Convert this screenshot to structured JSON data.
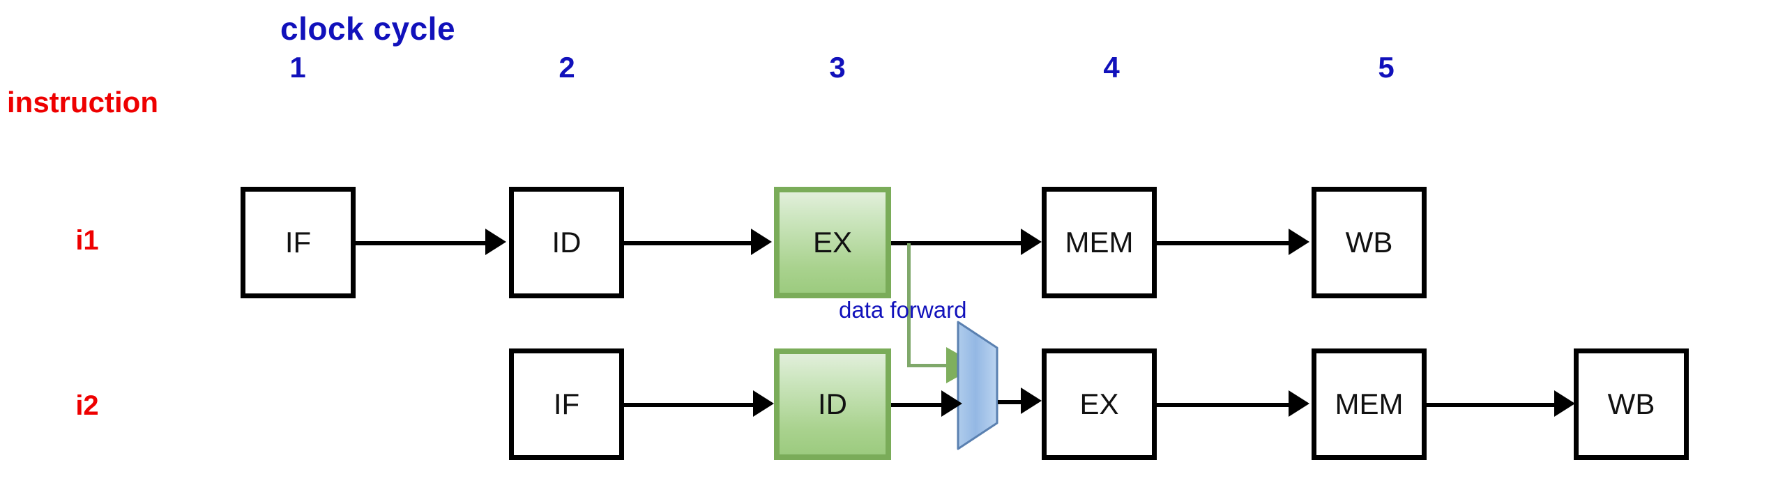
{
  "diagram": {
    "title": "clock cycle",
    "axis_label_instruction": "instruction",
    "colors": {
      "cycle_label": "#1111BB",
      "instruction_label": "#EE0000",
      "highlight_stage": "#9CCB7F",
      "mux": "#8FB7E0",
      "forward_path": "#7FAF5E",
      "box_border": "#000000"
    },
    "clock_cycles": [
      {
        "n": "1"
      },
      {
        "n": "2"
      },
      {
        "n": "3"
      },
      {
        "n": "4"
      },
      {
        "n": "5"
      }
    ],
    "rows": [
      {
        "label": "i1",
        "stages": [
          {
            "name": "IF",
            "highlight": "false"
          },
          {
            "name": "ID",
            "highlight": "false"
          },
          {
            "name": "EX",
            "highlight": "true"
          },
          {
            "name": "MEM",
            "highlight": "false"
          },
          {
            "name": "WB",
            "highlight": "false"
          }
        ]
      },
      {
        "label": "i2",
        "stages": [
          {
            "name": "IF",
            "highlight": "false"
          },
          {
            "name": "ID",
            "highlight": "true"
          },
          {
            "name": "EX",
            "highlight": "false"
          },
          {
            "name": "MEM",
            "highlight": "false"
          },
          {
            "name": "WB",
            "highlight": "false"
          }
        ]
      }
    ],
    "annotation": {
      "forward_label": "data forward"
    }
  }
}
